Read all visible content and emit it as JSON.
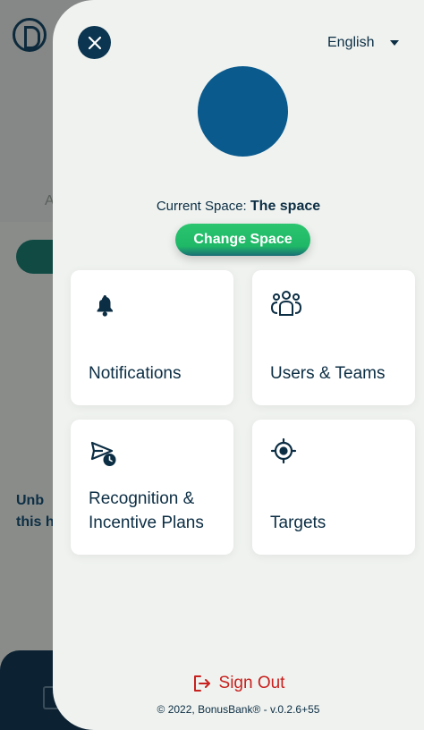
{
  "background": {
    "tab_label": "A",
    "text_line1": "Unb",
    "text_line2": "this h"
  },
  "drawer": {
    "language": "English",
    "current_space_label": "Current Space:",
    "current_space_name": "The space",
    "change_space_label": "Change Space",
    "cards": [
      {
        "label": "Notifications",
        "icon": "bell-icon"
      },
      {
        "label": "Users & Teams",
        "icon": "users-icon"
      },
      {
        "label": "Recognition &\nIncentive Plans",
        "icon": "send-clock-icon"
      },
      {
        "label": "Targets",
        "icon": "target-icon"
      }
    ],
    "sign_out_label": "Sign Out",
    "footer": "© 2022, BonusBank® - v.0.2.6+55"
  },
  "colors": {
    "primary": "#0b3550",
    "accent_green": "#22bf6b",
    "danger": "#c8211e",
    "avatar": "#0a5a8e"
  }
}
